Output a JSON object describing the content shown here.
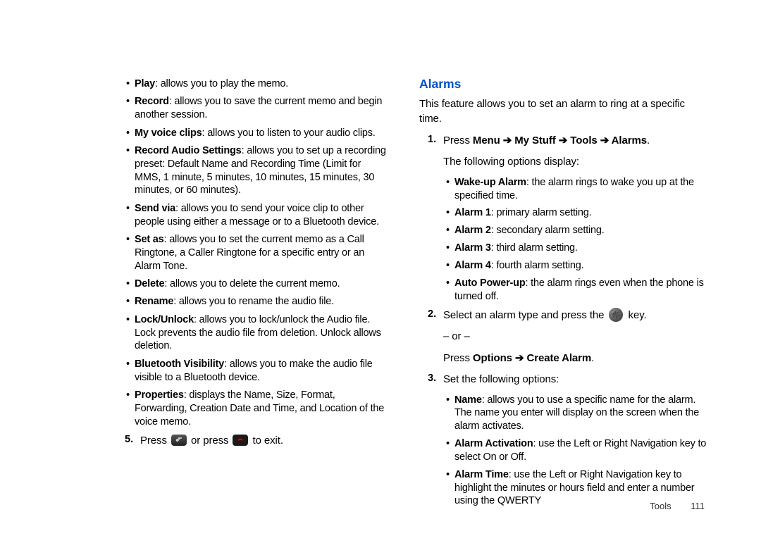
{
  "left": {
    "bullets": [
      {
        "term": "Play",
        "desc": ": allows you to play the memo."
      },
      {
        "term": "Record",
        "desc": ": allows you to save the current memo and begin another session."
      },
      {
        "term": "My voice clips",
        "desc": ": allows you to listen to your audio clips."
      },
      {
        "term": "Record Audio Settings",
        "desc": ": allows you to set up a recording preset: Default Name and Recording Time (Limit for MMS, 1 minute, 5 minutes, 10 minutes, 15 minutes, 30 minutes, or 60 minutes)."
      },
      {
        "term": "Send via",
        "desc": ": allows you to send your voice clip to other people using either a message or to a Bluetooth device."
      },
      {
        "term": "Set as",
        "desc": ": allows you to set the current memo as a Call Ringtone, a Caller Ringtone for a specific entry or an Alarm Tone."
      },
      {
        "term": "Delete",
        "desc": ": allows you to delete the current memo."
      },
      {
        "term": "Rename",
        "desc": ": allows you to rename the audio file."
      },
      {
        "term": "Lock/Unlock",
        "desc": ": allows you to lock/unlock the Audio file. Lock prevents the audio file from deletion. Unlock allows deletion."
      },
      {
        "term": "Bluetooth Visibility",
        "desc": ": allows you to make the audio file visible to a Bluetooth device."
      },
      {
        "term": "Properties",
        "desc": ": displays the Name, Size, Format, Forwarding, Creation Date and Time, and Location of the voice memo."
      }
    ],
    "step5": {
      "num": "5.",
      "pre": "Press ",
      "mid": " or press ",
      "post": " to exit."
    }
  },
  "right": {
    "title": "Alarms",
    "intro": "This feature allows you to set an alarm to ring at a specific time.",
    "step1": {
      "num": "1.",
      "press": "Press ",
      "path": "Menu ➔ My Stuff ➔ Tools ➔ Alarms",
      "dot": ".",
      "follow": "The following options display:"
    },
    "alarmOptions": [
      {
        "term": "Wake-up Alarm",
        "desc": ": the alarm rings to wake you up at the specified time."
      },
      {
        "term": "Alarm 1",
        "desc": ": primary alarm setting."
      },
      {
        "term": "Alarm 2",
        "desc": ": secondary alarm setting."
      },
      {
        "term": "Alarm 3",
        "desc": ": third alarm setting."
      },
      {
        "term": "Alarm 4",
        "desc": ": fourth alarm setting."
      },
      {
        "term": "Auto Power-up",
        "desc": ": the alarm rings even when the phone is turned off."
      }
    ],
    "step2": {
      "num": "2.",
      "pre": "Select an alarm type and press the ",
      "post": " key.",
      "or": "– or –",
      "press": "Press ",
      "path": "Options ➔ Create Alarm",
      "dot": "."
    },
    "step3": {
      "num": "3.",
      "text": "Set the following options:"
    },
    "setOptions": [
      {
        "term": "Name",
        "desc": ": allows you to use a specific name for the alarm. The name you enter will display on the screen when the alarm activates."
      },
      {
        "term": "Alarm Activation",
        "desc": ": use the Left or Right Navigation key to select On or Off."
      },
      {
        "term": "Alarm Time",
        "desc": ": use the Left or Right Navigation key to highlight the minutes or hours field and enter a number using the QWERTY"
      }
    ]
  },
  "footer": {
    "section": "Tools",
    "page": "111"
  }
}
